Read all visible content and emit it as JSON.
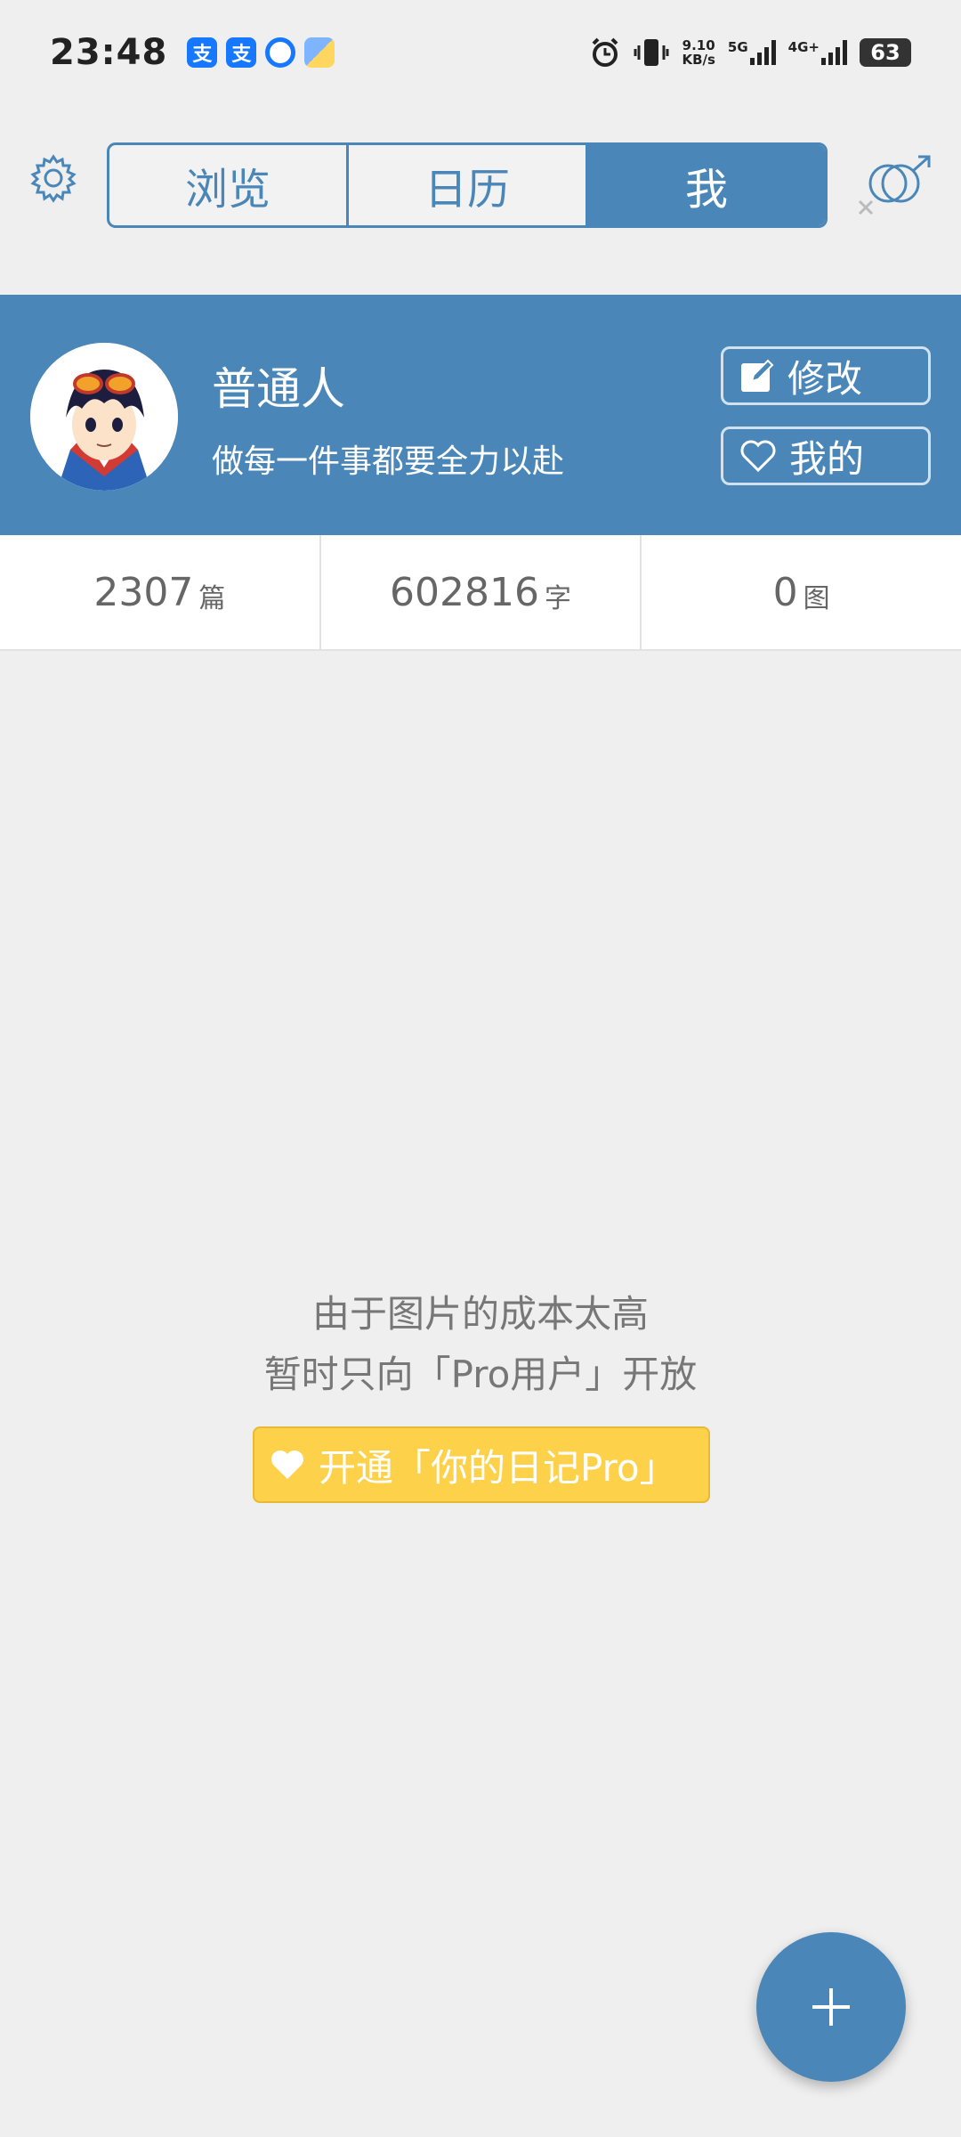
{
  "status_bar": {
    "time": "23:48",
    "notification_icons": [
      "alipay-icon",
      "alipay-icon",
      "browser-icon",
      "doc-icon"
    ],
    "net_speed": "9.10",
    "net_unit": "KB/s",
    "signal1_label": "5G",
    "signal2_label": "4G+",
    "battery": "63"
  },
  "header": {
    "tabs": [
      {
        "label": "浏览",
        "active": false
      },
      {
        "label": "日历",
        "active": false
      },
      {
        "label": "我",
        "active": true
      }
    ]
  },
  "profile": {
    "name": "普通人",
    "motto": "做每一件事都要全力以赴",
    "edit_label": "修改",
    "mine_label": "我的"
  },
  "stats": [
    {
      "value": "2307",
      "unit": "篇"
    },
    {
      "value": "602816",
      "unit": "字"
    },
    {
      "value": "0",
      "unit": "图"
    }
  ],
  "message": {
    "line1": "由于图片的成本太高",
    "line2": "暂时只向「Pro用户」开放",
    "button_label": "开通「你的日记Pro」"
  },
  "colors": {
    "accent": "#4a87b8",
    "pro_yellow": "#fdd14a",
    "background": "#efefef"
  }
}
